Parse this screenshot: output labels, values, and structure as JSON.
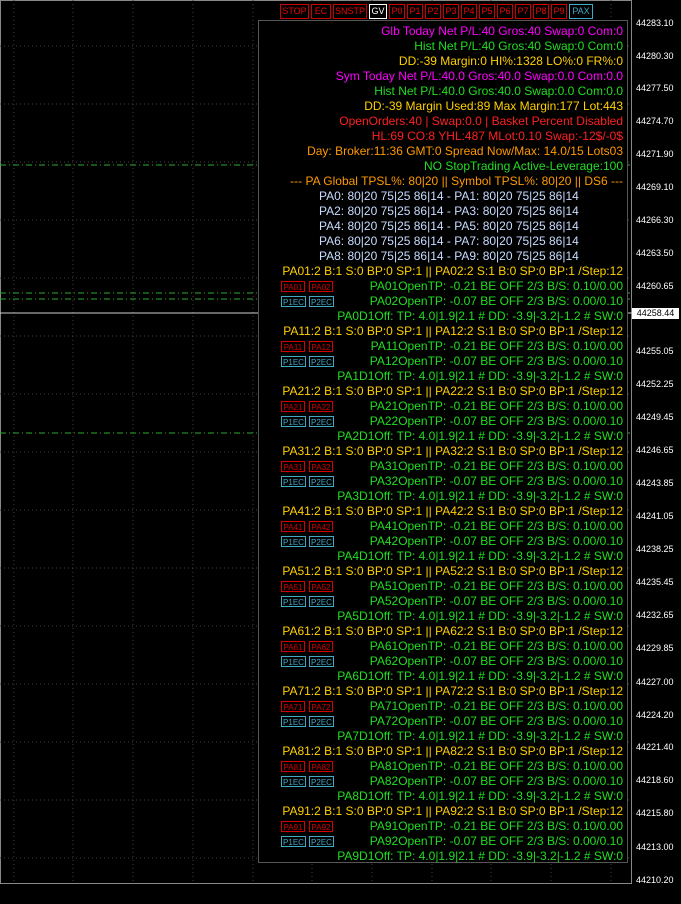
{
  "colors": {
    "magenta": "#ff00ff",
    "green": "#22dd22",
    "yellow": "#ffd000",
    "red": "#ff2020",
    "orange": "#ff9900",
    "white": "#ffffff",
    "lightblue": "#c8dcff",
    "gridline": "#404040",
    "hline_green": "#2fa92f"
  },
  "toolbar": [
    {
      "label": "STOP",
      "style": "red"
    },
    {
      "label": "EC",
      "style": "red"
    },
    {
      "label": "SNSTP",
      "style": "red"
    },
    {
      "label": "GV",
      "style": "gv"
    },
    {
      "label": "P0",
      "style": "red"
    },
    {
      "label": "P1",
      "style": "red"
    },
    {
      "label": "P2",
      "style": "red"
    },
    {
      "label": "P3",
      "style": "red"
    },
    {
      "label": "P4",
      "style": "red"
    },
    {
      "label": "P5",
      "style": "red"
    },
    {
      "label": "P6",
      "style": "red"
    },
    {
      "label": "P7",
      "style": "red"
    },
    {
      "label": "P8",
      "style": "red"
    },
    {
      "label": "P9",
      "style": "red"
    },
    {
      "label": "PAX",
      "style": "pax"
    }
  ],
  "price_axis": {
    "labels": [
      "44283.10",
      "44280.30",
      "44277.50",
      "44274.70",
      "44271.90",
      "44269.10",
      "44266.30",
      "44263.50",
      "44260.65",
      "44255.05",
      "44252.25",
      "44249.45",
      "44246.65",
      "44243.85",
      "44241.05",
      "44238.25",
      "44235.45",
      "44232.65",
      "44229.85",
      "44227.00",
      "44224.20",
      "44221.40",
      "44218.60",
      "44215.80",
      "44213.00",
      "44210.20"
    ],
    "current_price": "44258.44"
  },
  "header_lines": [
    {
      "text": "Glb Today Net P/L:40 Gros:40 Swap:0 Com:0",
      "color": "magenta"
    },
    {
      "text": "Hist Net P/L:40 Gros:40 Swap:0 Com:0",
      "color": "green"
    },
    {
      "text": "DD:-39 Margin:0 HI%:1328 LO%:0 FR%:0",
      "color": "yellow"
    },
    {
      "text": "Sym Today Net P/L:40.0 Gros:40.0 Swap:0.0 Com:0.0",
      "color": "magenta"
    },
    {
      "text": "Hist Net P/L:40.0 Gros:40.0 Swap:0.0 Com:0.0",
      "color": "green"
    },
    {
      "text": "DD:-39 Margin Used:89 Max Margin:177 Lot:443",
      "color": "yellow"
    },
    {
      "text": "OpenOrders:40 | Swap:0.0 | Basket Percent Disabled",
      "color": "red"
    },
    {
      "text": "HL:69 CO:8 YHL:487 MLot:0.10 Swap:-12$/-0$",
      "color": "red"
    },
    {
      "text": "Day: Broker:11:36 GMT:0  Spread Now/Max: 14.0/15 Lots03",
      "color": "orange"
    },
    {
      "text": "NO StopTrading Active-Leverage:100",
      "color": "green"
    },
    {
      "text": "--- PA Global TPSL%: 80|20 || Symbol TPSL%: 80|20 || DS6 ---",
      "color": "orange"
    }
  ],
  "pa_config_lines": [
    "PA0: 80|20 75|25 86|14 - PA1: 80|20 75|25 86|14",
    "PA2: 80|20 75|25 86|14 - PA3: 80|20 75|25 86|14",
    "PA4: 80|20 75|25 86|14 - PA5: 80|20 75|25 86|14",
    "PA6: 80|20 75|25 86|14 - PA7: 80|20 75|25 86|14",
    "PA8: 80|20 75|25 86|14 - PA9: 80|20 75|25 86|14"
  ],
  "pa_groups": [
    {
      "status": "PA01:2 B:1 S:0 BP:0 SP:1 || PA02:2 S:1 B:0 SP:0 BP:1 /Step:12",
      "open1": "PA01OpenTP: -0.21 BE OFF 2/3 B/S: 0.10/0.00",
      "open2": "PA02OpenTP: -0.07 BE OFF 2/3 B/S: 0.00/0.10",
      "off": "PA0D1Off: TP: 4.0|1.9|2.1 # DD: -3.9|-3.2|-1.2 # SW:0",
      "btn_r1": "PA01",
      "btn_r2": "PA02",
      "btn_b1": "P1EC",
      "btn_b2": "P2EC"
    },
    {
      "status": "PA11:2 B:1 S:0 BP:0 SP:1 || PA12:2 S:1 B:0 SP:0 BP:1 /Step:12",
      "open1": "PA11OpenTP: -0.21 BE OFF 2/3 B/S: 0.10/0.00",
      "open2": "PA12OpenTP: -0.07 BE OFF 2/3 B/S: 0.00/0.10",
      "off": "PA1D1Off: TP: 4.0|1.9|2.1 # DD: -3.9|-3.2|-1.2 # SW:0",
      "btn_r1": "PA11",
      "btn_r2": "PA12",
      "btn_b1": "P1EC",
      "btn_b2": "P2EC"
    },
    {
      "status": "PA21:2 B:1 S:0 BP:0 SP:1 || PA22:2 S:1 B:0 SP:0 BP:1 /Step:12",
      "open1": "PA21OpenTP: -0.21 BE OFF 2/3 B/S: 0.10/0.00",
      "open2": "PA22OpenTP: -0.07 BE OFF 2/3 B/S: 0.00/0.10",
      "off": "PA2D1Off: TP: 4.0|1.9|2.1 # DD: -3.9|-3.2|-1.2 # SW:0",
      "btn_r1": "PA21",
      "btn_r2": "PA22",
      "btn_b1": "P1EC",
      "btn_b2": "P2EC"
    },
    {
      "status": "PA31:2 B:1 S:0 BP:0 SP:1 || PA32:2 S:1 B:0 SP:0 BP:1 /Step:12",
      "open1": "PA31OpenTP: -0.21 BE OFF 2/3 B/S: 0.10/0.00",
      "open2": "PA32OpenTP: -0.07 BE OFF 2/3 B/S: 0.00/0.10",
      "off": "PA3D1Off: TP: 4.0|1.9|2.1 # DD: -3.9|-3.2|-1.2 # SW:0",
      "btn_r1": "PA31",
      "btn_r2": "PA32",
      "btn_b1": "P1EC",
      "btn_b2": "P2EC"
    },
    {
      "status": "PA41:2 B:1 S:0 BP:0 SP:1 || PA42:2 S:1 B:0 SP:0 BP:1 /Step:12",
      "open1": "PA41OpenTP: -0.21 BE OFF 2/3 B/S: 0.10/0.00",
      "open2": "PA42OpenTP: -0.07 BE OFF 2/3 B/S: 0.00/0.10",
      "off": "PA4D1Off: TP: 4.0|1.9|2.1 # DD: -3.9|-3.2|-1.2 # SW:0",
      "btn_r1": "PA41",
      "btn_r2": "PA42",
      "btn_b1": "P1EC",
      "btn_b2": "P2EC"
    },
    {
      "status": "PA51:2 B:1 S:0 BP:0 SP:1 || PA52:2 S:1 B:0 SP:0 BP:1 /Step:12",
      "open1": "PA51OpenTP: -0.21 BE OFF 2/3 B/S: 0.10/0.00",
      "open2": "PA52OpenTP: -0.07 BE OFF 2/3 B/S: 0.00/0.10",
      "off": "PA5D1Off: TP: 4.0|1.9|2.1 # DD: -3.9|-3.2|-1.2 # SW:0",
      "btn_r1": "PA51",
      "btn_r2": "PA52",
      "btn_b1": "P1EC",
      "btn_b2": "P2EC"
    },
    {
      "status": "PA61:2 B:1 S:0 BP:0 SP:1 || PA62:2 S:1 B:0 SP:0 BP:1 /Step:12",
      "open1": "PA61OpenTP: -0.21 BE OFF 2/3 B/S: 0.10/0.00",
      "open2": "PA62OpenTP: -0.07 BE OFF 2/3 B/S: 0.00/0.10",
      "off": "PA6D1Off: TP: 4.0|1.9|2.1 # DD: -3.9|-3.2|-1.2 # SW:0",
      "btn_r1": "PA61",
      "btn_r2": "PA62",
      "btn_b1": "P1EC",
      "btn_b2": "P2EC"
    },
    {
      "status": "PA71:2 B:1 S:0 BP:0 SP:1 || PA72:2 S:1 B:0 SP:0 BP:1 /Step:12",
      "open1": "PA71OpenTP: -0.21 BE OFF 2/3 B/S: 0.10/0.00",
      "open2": "PA72OpenTP: -0.07 BE OFF 2/3 B/S: 0.00/0.10",
      "off": "PA7D1Off: TP: 4.0|1.9|2.1 # DD: -3.9|-3.2|-1.2 # SW:0",
      "btn_r1": "PA71",
      "btn_r2": "PA72",
      "btn_b1": "P1EC",
      "btn_b2": "P2EC"
    },
    {
      "status": "PA81:2 B:1 S:0 BP:0 SP:1 || PA82:2 S:1 B:0 SP:0 BP:1 /Step:12",
      "open1": "PA81OpenTP: -0.21 BE OFF 2/3 B/S: 0.10/0.00",
      "open2": "PA82OpenTP: -0.07 BE OFF 2/3 B/S: 0.00/0.10",
      "off": "PA8D1Off: TP: 4.0|1.9|2.1 # DD: -3.9|-3.2|-1.2 # SW:0",
      "btn_r1": "PA81",
      "btn_r2": "PA82",
      "btn_b1": "P1EC",
      "btn_b2": "P2EC"
    },
    {
      "status": "PA91:2 B:1 S:0 BP:0 SP:1 || PA92:2 S:1 B:0 SP:0 BP:1 /Step:12",
      "open1": "PA91OpenTP: -0.21 BE OFF 2/3 B/S: 0.10/0.00",
      "open2": "PA92OpenTP: -0.07 BE OFF 2/3 B/S: 0.00/0.10",
      "off": "PA9D1Off: TP: 4.0|1.9|2.1 # DD: -3.9|-3.2|-1.2 # SW:0",
      "btn_r1": "PA91",
      "btn_r2": "PA92",
      "btn_b1": "P1EC",
      "btn_b2": "P2EC"
    }
  ]
}
